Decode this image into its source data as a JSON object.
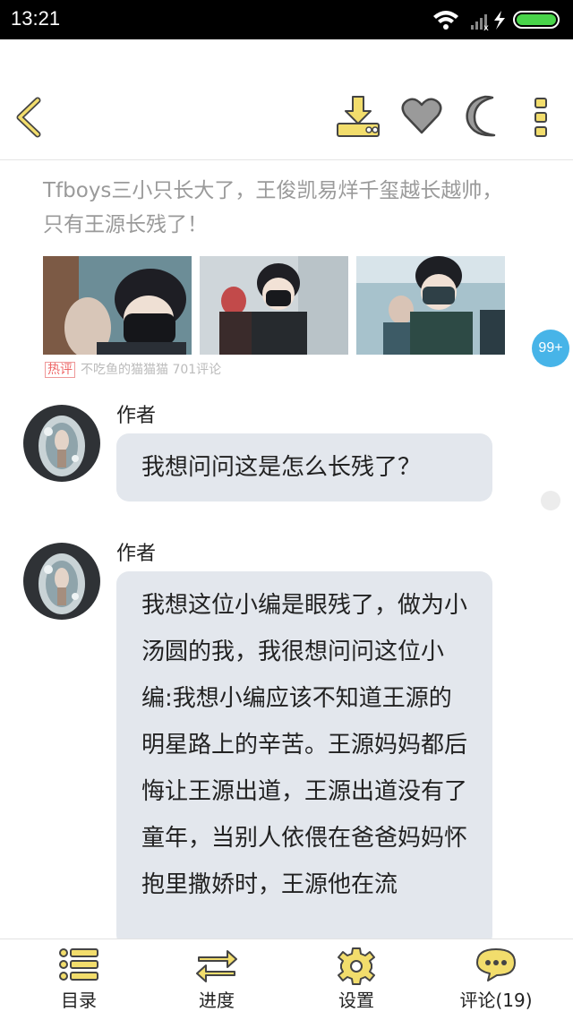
{
  "status_bar": {
    "time": "13:21"
  },
  "article": {
    "title": "Tfboys三小只长大了，王俊凯易烊千玺越长越帅，只有王源长残了！",
    "hot_tag": "热评",
    "meta": "不吃鱼的猫猫猫  701评论"
  },
  "badge": "99+",
  "comments": [
    {
      "author": "作者",
      "text": "我想问问这是怎么长残了？"
    },
    {
      "author": "作者",
      "text": "我想这位小编是眼残了，做为小汤圆的我，我很想问问这位小编:我想小编应该不知道王源的明星路上的辛苦。王源妈妈都后悔让王源出道，王源出道没有了童年，当别人依偎在爸爸妈妈怀抱里撒娇时，王源他在流"
    }
  ],
  "bottom_nav": [
    {
      "label": "目录",
      "icon": "list-icon"
    },
    {
      "label": "进度",
      "icon": "swap-icon"
    },
    {
      "label": "设置",
      "icon": "gear-icon"
    },
    {
      "label": "评论(19)",
      "icon": "chat-icon"
    }
  ],
  "colors": {
    "accent_yellow": "#f2dd6c",
    "icon_outline": "#4a4a4a",
    "badge_blue": "#47b4e8",
    "bubble_bg": "#e3e7ed"
  }
}
